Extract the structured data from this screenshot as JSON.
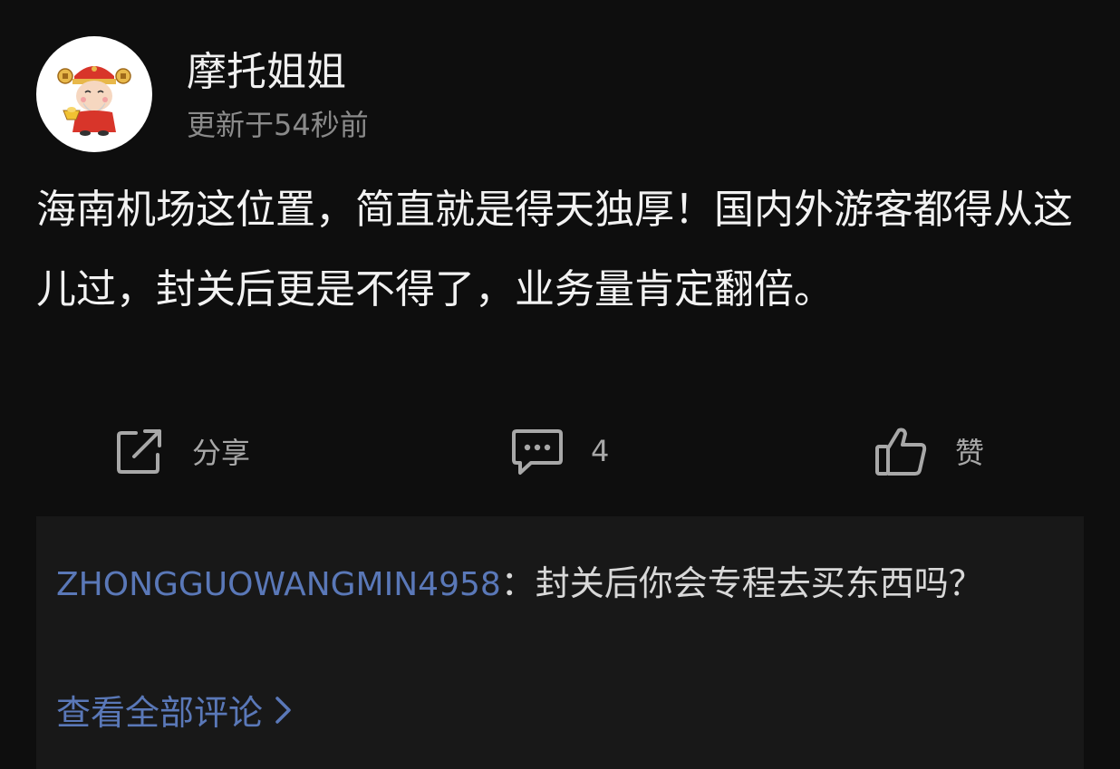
{
  "post": {
    "author": "摩托姐姐",
    "updated": "更新于54秒前",
    "body": "海南机场这位置，简直就是得天独厚！国内外游客都得从这儿过，封关后更是不得了，业务量肯定翻倍。"
  },
  "actions": {
    "share_label": "分享",
    "comment_count": "4",
    "like_label": "赞"
  },
  "comments": {
    "items": [
      {
        "author": "ZHONGGUOWANGMIN4958",
        "separator": "：",
        "text": "封关后你会专程去买东西吗？"
      }
    ],
    "view_all_label": "查看全部评论"
  },
  "colors": {
    "background": "#0e0e0e",
    "comment_panel": "#181818",
    "link_blue": "#5a78b8",
    "secondary_text": "#8a8a8a"
  },
  "icons": {
    "share": "share-icon",
    "comment": "comment-icon",
    "like": "thumbs-up-icon",
    "view_all": "chevron-right-icon"
  }
}
